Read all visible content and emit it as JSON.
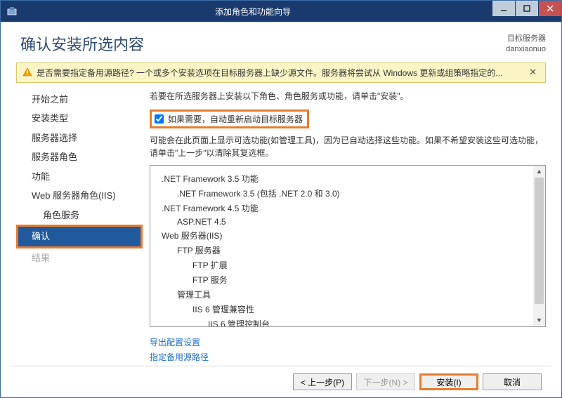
{
  "titlebar": {
    "title": "添加角色和功能向导"
  },
  "header": {
    "page_title": "确认安装所选内容",
    "dest_label": "目标服务器",
    "dest_value": "danxiaonuo"
  },
  "warn": {
    "text": "是否需要指定备用源路径? 一个或多个安装选项在目标服务器上缺少源文件。服务器将尝试从 Windows 更新或组策略指定的..."
  },
  "sidebar": {
    "items": [
      {
        "label": "开始之前"
      },
      {
        "label": "安装类型"
      },
      {
        "label": "服务器选择"
      },
      {
        "label": "服务器角色"
      },
      {
        "label": "功能"
      },
      {
        "label": "Web 服务器角色(IIS)"
      },
      {
        "label": "角色服务"
      },
      {
        "label": "确认"
      },
      {
        "label": "结果"
      }
    ]
  },
  "main": {
    "instr": "若要在所选服务器上安装以下角色、角色服务或功能，请单击\"安装\"。",
    "chk_label": "如果需要，自动重新启动目标服务器",
    "explain": "可能会在此页面上显示可选功能(如管理工具)，因为已自动选择这些功能。如果不希望安装这些可选功能，请单击\"上一步\"以清除其复选框。",
    "list": [
      {
        "lvl": 1,
        "text": ".NET Framework 3.5 功能"
      },
      {
        "lvl": 2,
        "text": ".NET Framework 3.5 (包括 .NET 2.0 和 3.0)"
      },
      {
        "lvl": 1,
        "text": ".NET Framework 4.5 功能"
      },
      {
        "lvl": 2,
        "text": "ASP.NET 4.5"
      },
      {
        "lvl": 1,
        "text": "Web 服务器(IIS)"
      },
      {
        "lvl": 2,
        "text": "FTP 服务器"
      },
      {
        "lvl": 3,
        "text": "FTP 扩展"
      },
      {
        "lvl": 3,
        "text": "FTP 服务"
      },
      {
        "lvl": 2,
        "text": "管理工具"
      },
      {
        "lvl": 3,
        "text": "IIS 6 管理兼容性"
      },
      {
        "lvl": 4,
        "text": "IIS 6 管理控制台"
      }
    ],
    "link1": "导出配置设置",
    "link2": "指定备用源路径"
  },
  "footer": {
    "prev": "< 上一步(P)",
    "next": "下一步(N) >",
    "install": "安装(I)",
    "cancel": "取消"
  }
}
